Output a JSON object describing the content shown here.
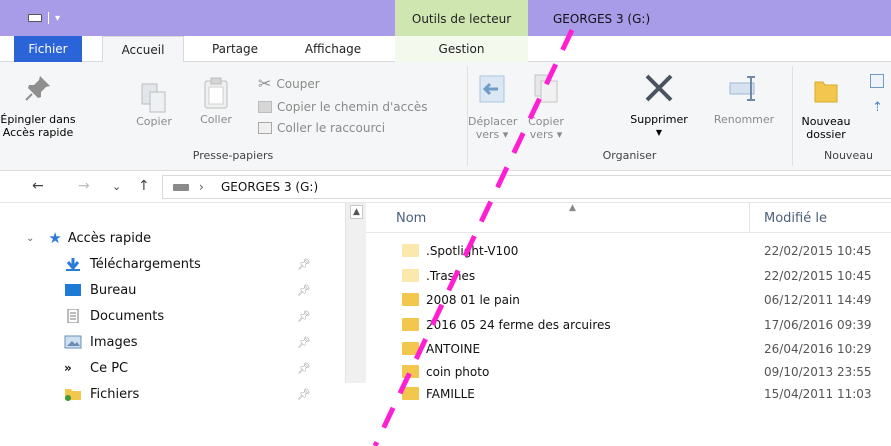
{
  "window": {
    "context_tab_group": "Outils de lecteur",
    "title": "GEORGES 3 (G:)"
  },
  "tabs": {
    "file": "Fichier",
    "home": "Accueil",
    "share": "Partage",
    "view": "Affichage",
    "manage": "Gestion"
  },
  "ribbon": {
    "pin_label_1": "Épingler dans",
    "pin_label_2": "Accès rapide",
    "copy": "Copier",
    "paste": "Coller",
    "cut": "Couper",
    "copy_path": "Copier le chemin d'accès",
    "paste_shortcut": "Coller le raccourci",
    "clipboard_group": "Presse-papiers",
    "move_to_1": "Déplacer",
    "move_to_2": "vers",
    "copy_to_1": "Copier",
    "copy_to_2": "vers",
    "delete": "Supprimer",
    "rename": "Renommer",
    "organize_group": "Organiser",
    "new_folder_1": "Nouveau",
    "new_folder_2": "dossier",
    "new_group": "Nouveau"
  },
  "address": {
    "path": "GEORGES 3 (G:)"
  },
  "navpane": {
    "quick_access": "Accès rapide",
    "items": [
      {
        "label": "Téléchargements",
        "icon": "download-icon"
      },
      {
        "label": "Bureau",
        "icon": "desktop-icon"
      },
      {
        "label": "Documents",
        "icon": "documents-icon"
      },
      {
        "label": "Images",
        "icon": "images-icon"
      },
      {
        "label": "Ce PC",
        "icon": "this-pc-icon"
      },
      {
        "label": "Fichiers",
        "icon": "folder-icon"
      }
    ]
  },
  "filelist": {
    "col_name": "Nom",
    "col_modified": "Modifié le",
    "rows": [
      {
        "name": ".Spotlight-V100",
        "modified": "22/02/2015 10:45"
      },
      {
        "name": ".Trashes",
        "modified": "22/02/2015 10:45"
      },
      {
        "name": "2008 01 le pain",
        "modified": "06/12/2011 14:49"
      },
      {
        "name": "2016 05 24 ferme des arcuires",
        "modified": "17/06/2016 09:39"
      },
      {
        "name": "ANTOINE",
        "modified": "26/04/2016 10:29"
      },
      {
        "name": "coin photo",
        "modified": "09/10/2013 23:55"
      },
      {
        "name": "FAMILLE",
        "modified": "15/04/2011 11:03"
      }
    ]
  },
  "colors": {
    "titlebar": "#a89be8",
    "file_tab": "#2b63d9",
    "context_tab": "#cfe6b0",
    "annotation_line": "#ff1fd2",
    "folder": "#f3c64e",
    "hidden_folder": "#fbe8ad"
  }
}
